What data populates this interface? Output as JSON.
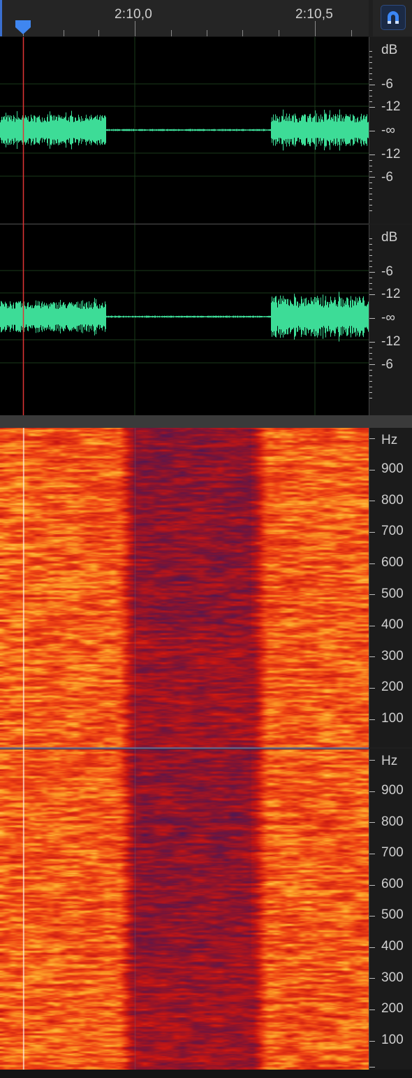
{
  "timeline": {
    "time_labels": [
      "2:10,0",
      "2:10,5"
    ]
  },
  "toolbar": {
    "snap_icon": "magnet-icon",
    "snap_color": "#3b86f5"
  },
  "waveform": {
    "wave_color": "#3ddc97",
    "playhead_color": "#e03434",
    "channels": [
      {
        "unit": "dB",
        "labels": [
          "-6",
          "-12",
          "-∞",
          "-12",
          "-6"
        ]
      },
      {
        "unit": "dB",
        "labels": [
          "-6",
          "-12",
          "-∞",
          "-12",
          "-6"
        ]
      }
    ]
  },
  "spectrogram": {
    "channels": [
      {
        "unit": "Hz",
        "labels": [
          "900",
          "800",
          "700",
          "600",
          "500",
          "400",
          "300",
          "200",
          "100"
        ]
      },
      {
        "unit": "Hz",
        "labels": [
          "900",
          "800",
          "700",
          "600",
          "500",
          "400",
          "300",
          "200",
          "100"
        ]
      }
    ]
  }
}
